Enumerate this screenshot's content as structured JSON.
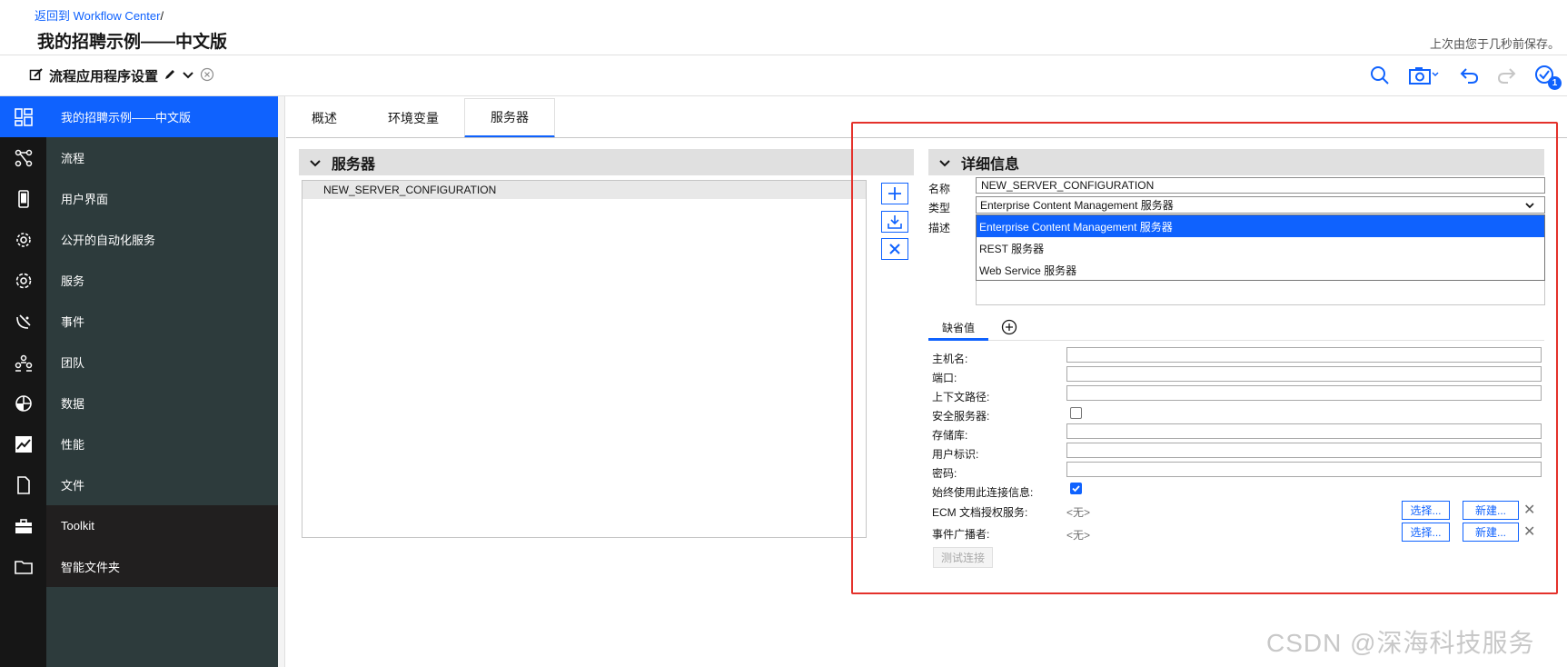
{
  "header": {
    "back_link": "返回到 Workflow Center",
    "back_sep": "/",
    "title": "我的招聘示例——中文版",
    "saved_status": "上次由您于几秒前保存。"
  },
  "toolbar": {
    "settings_label": "流程应用程序设置",
    "badge_count": "1",
    "icons": [
      "search-icon",
      "snapshot-icon",
      "undo-icon",
      "redo-icon",
      "validation-icon"
    ]
  },
  "sidebar": {
    "items": [
      {
        "label": "我的招聘示例——中文版",
        "icon": "dashboard-icon"
      },
      {
        "label": "流程",
        "icon": "flow-icon"
      },
      {
        "label": "用户界面",
        "icon": "mobile-icon"
      },
      {
        "label": "公开的自动化服务",
        "icon": "gear-cog-icon"
      },
      {
        "label": "服务",
        "icon": "settings-icon"
      },
      {
        "label": "事件",
        "icon": "satellite-icon"
      },
      {
        "label": "团队",
        "icon": "team-icon"
      },
      {
        "label": "数据",
        "icon": "pie-icon"
      },
      {
        "label": "性能",
        "icon": "chart-icon"
      },
      {
        "label": "文件",
        "icon": "document-icon"
      },
      {
        "label": "Toolkit",
        "icon": "toolbox-icon"
      },
      {
        "label": "智能文件夹",
        "icon": "folder-icon"
      }
    ]
  },
  "tabs": [
    "概述",
    "环境变量",
    "服务器"
  ],
  "servers": {
    "title": "服务器",
    "items": [
      "NEW_SERVER_CONFIGURATION"
    ]
  },
  "details": {
    "title": "详细信息",
    "name_label": "名称",
    "name_value": "NEW_SERVER_CONFIGURATION",
    "type_label": "类型",
    "type_value": "Enterprise Content Management 服务器",
    "desc_label": "描述",
    "type_options": [
      "Enterprise Content Management 服务器",
      "REST 服务器",
      "Web Service 服务器"
    ],
    "subtab": "缺省值",
    "fields": {
      "host": "主机名:",
      "port": "端口:",
      "context": "上下文路径:",
      "secure": "安全服务器:",
      "repository": "存储库:",
      "userid": "用户标识:",
      "password": "密码:",
      "always_use": "始终使用此连接信息:",
      "ecm_auth": "ECM 文档授权服务:",
      "event_broadcaster": "事件广播者:"
    },
    "none_value": "<无>",
    "select_btn": "选择...",
    "new_btn": "新建...",
    "test_btn": "测试连接",
    "secure_checked": false,
    "always_use_checked": true
  },
  "watermark": "CSDN @深海科技服务"
}
